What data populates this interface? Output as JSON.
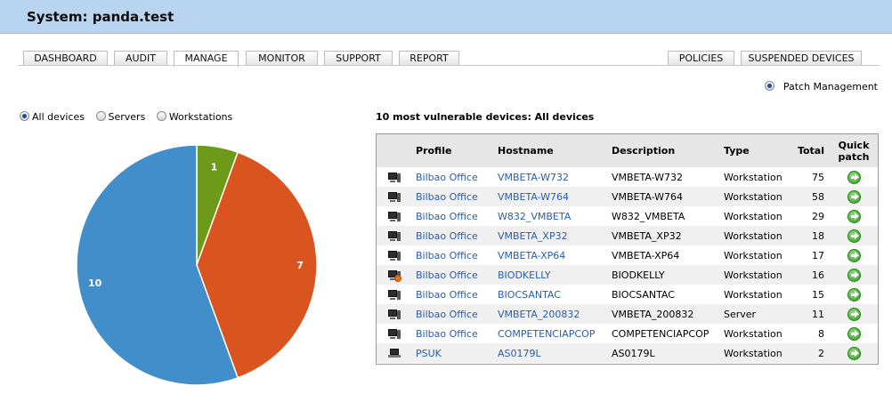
{
  "header": {
    "title": "System: panda.test"
  },
  "tabs": [
    {
      "label": "DASHBOARD",
      "active": false
    },
    {
      "label": "AUDIT",
      "active": false
    },
    {
      "label": "MANAGE",
      "active": true
    },
    {
      "label": "MONITOR",
      "active": false
    },
    {
      "label": "SUPPORT",
      "active": false
    },
    {
      "label": "REPORT",
      "active": false
    }
  ],
  "right_tabs": [
    {
      "label": "POLICIES"
    },
    {
      "label": "SUSPENDED DEVICES"
    }
  ],
  "patch_management": {
    "label": "Patch Management",
    "selected": true
  },
  "filters": [
    {
      "label": "All devices",
      "selected": true
    },
    {
      "label": "Servers",
      "selected": false
    },
    {
      "label": "Workstations",
      "selected": false
    }
  ],
  "chart_data": {
    "type": "pie",
    "values": [
      1,
      7,
      10
    ],
    "labels": [
      "1",
      "7",
      "10"
    ],
    "colors": [
      "#6e9a1a",
      "#d9541e",
      "#428ecb"
    ]
  },
  "table": {
    "caption": "10 most vulnerable devices: All devices",
    "columns": {
      "profile": "Profile",
      "hostname": "Hostname",
      "description": "Description",
      "type": "Type",
      "total": "Total",
      "quick_patch": "Quick patch"
    },
    "rows": [
      {
        "icon": "desktop-icon",
        "profile": "Bilbao Office",
        "hostname": "VMBETA-W732",
        "description": "VMBETA-W732",
        "type": "Workstation",
        "total": "75"
      },
      {
        "icon": "desktop-icon",
        "profile": "Bilbao Office",
        "hostname": "VMBETA-W764",
        "description": "VMBETA-W764",
        "type": "Workstation",
        "total": "58"
      },
      {
        "icon": "desktop-icon",
        "profile": "Bilbao Office",
        "hostname": "W832_VMBETA",
        "description": "W832_VMBETA",
        "type": "Workstation",
        "total": "29"
      },
      {
        "icon": "desktop-icon",
        "profile": "Bilbao Office",
        "hostname": "VMBETA_XP32",
        "description": "VMBETA_XP32",
        "type": "Workstation",
        "total": "18"
      },
      {
        "icon": "desktop-icon",
        "profile": "Bilbao Office",
        "hostname": "VMBETA-XP64",
        "description": "VMBETA-XP64",
        "type": "Workstation",
        "total": "17"
      },
      {
        "icon": "desktop-warning-icon",
        "profile": "Bilbao Office",
        "hostname": "BIODKELLY",
        "description": "BIODKELLY",
        "type": "Workstation",
        "total": "16"
      },
      {
        "icon": "desktop-icon",
        "profile": "Bilbao Office",
        "hostname": "BIOCSANTAC",
        "description": "BIOCSANTAC",
        "type": "Workstation",
        "total": "15"
      },
      {
        "icon": "desktop-icon",
        "profile": "Bilbao Office",
        "hostname": "VMBETA_200832",
        "description": "VMBETA_200832",
        "type": "Server",
        "total": "11"
      },
      {
        "icon": "desktop-icon",
        "profile": "Bilbao Office",
        "hostname": "COMPETENCIAPCOP",
        "description": "COMPETENCIAPCOP",
        "type": "Workstation",
        "total": "8"
      },
      {
        "icon": "laptop-icon",
        "profile": "PSUK",
        "hostname": "AS0179L",
        "description": "AS0179L",
        "type": "Workstation",
        "total": "2"
      }
    ]
  }
}
